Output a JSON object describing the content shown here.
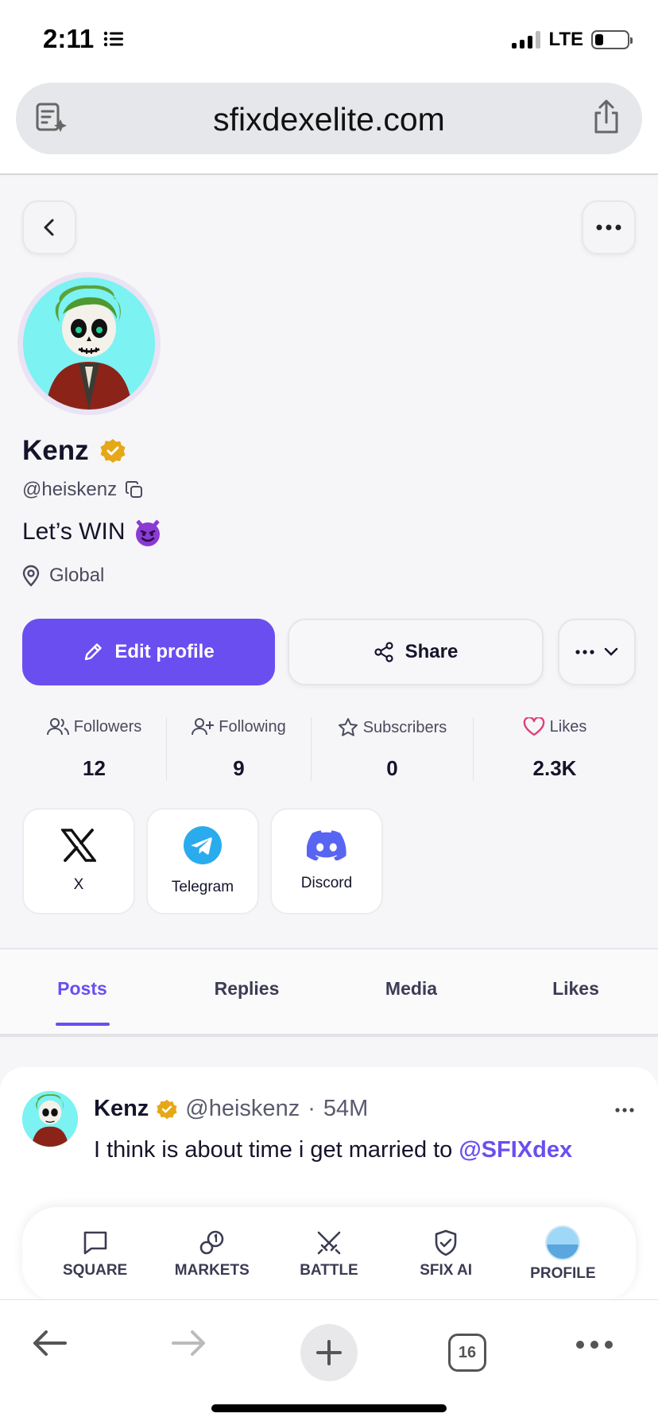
{
  "status_bar": {
    "time": "2:11",
    "network": "LTE"
  },
  "browser": {
    "url": "sfixdexelite.com",
    "tab_count": "16"
  },
  "profile": {
    "name": "Kenz",
    "handle": "@heiskenz",
    "bio": "Let’s WIN",
    "location": "Global",
    "actions": {
      "edit_label": "Edit profile",
      "share_label": "Share"
    },
    "stats": [
      {
        "label": "Followers",
        "value": "12",
        "icon": "followers-icon"
      },
      {
        "label": "Following",
        "value": "9",
        "icon": "add-user-icon"
      },
      {
        "label": "Subscribers",
        "value": "0",
        "icon": "star-icon"
      },
      {
        "label": "Likes",
        "value": "2.3K",
        "icon": "heart-icon"
      }
    ],
    "socials": [
      {
        "label": "X",
        "icon": "x-logo-icon"
      },
      {
        "label": "Telegram",
        "icon": "telegram-icon",
        "color": "#2AABEE"
      },
      {
        "label": "Discord",
        "icon": "discord-icon",
        "color": "#5865F2"
      }
    ]
  },
  "tabs": [
    {
      "label": "Posts",
      "active": true
    },
    {
      "label": "Replies"
    },
    {
      "label": "Media"
    },
    {
      "label": "Likes"
    }
  ],
  "post": {
    "author": "Kenz",
    "handle": "@heiskenz",
    "separator": "·",
    "age": "54M",
    "text": "I think is about time i get married to",
    "mention": "@SFIXdex"
  },
  "app_nav": [
    {
      "label": "SQUARE",
      "icon": "chat-square-icon"
    },
    {
      "label": "MARKETS",
      "icon": "markets-icon"
    },
    {
      "label": "BATTLE",
      "icon": "swords-icon"
    },
    {
      "label": "SFIX AI",
      "icon": "shield-check-icon"
    },
    {
      "label": "PROFILE",
      "icon": "profile-avatar"
    }
  ],
  "colors": {
    "accent": "#6B4EF0",
    "verified": "#E6A817",
    "likes_heart": "#E0407A"
  }
}
